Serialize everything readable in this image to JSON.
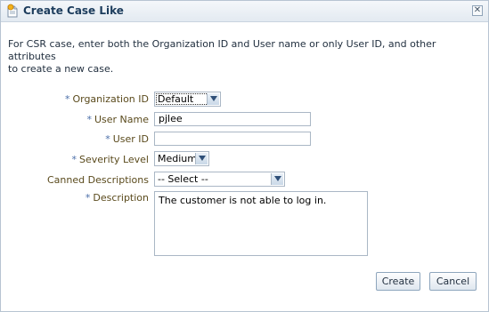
{
  "dialog": {
    "title": "Create Case Like",
    "close_glyph": "✕",
    "intro_line1": "For CSR case, enter both the Organization ID and User name or only User ID, and other attributes",
    "intro_line2": "to create a new case."
  },
  "form": {
    "required_mark": "*",
    "organization": {
      "label": "Organization ID",
      "value": "Default"
    },
    "user_name": {
      "label": "User Name",
      "value": "pjlee"
    },
    "user_id": {
      "label": "User ID",
      "value": ""
    },
    "severity": {
      "label": "Severity Level",
      "value": "Medium"
    },
    "canned": {
      "label": "Canned Descriptions",
      "value": "-- Select --"
    },
    "description": {
      "label": "Description",
      "value": "The customer is not able to log in."
    }
  },
  "buttons": {
    "create": "Create",
    "cancel": "Cancel"
  },
  "colors": {
    "title": "#1c3c5c",
    "label": "#5a4a1c",
    "required": "#4a6ea8"
  }
}
